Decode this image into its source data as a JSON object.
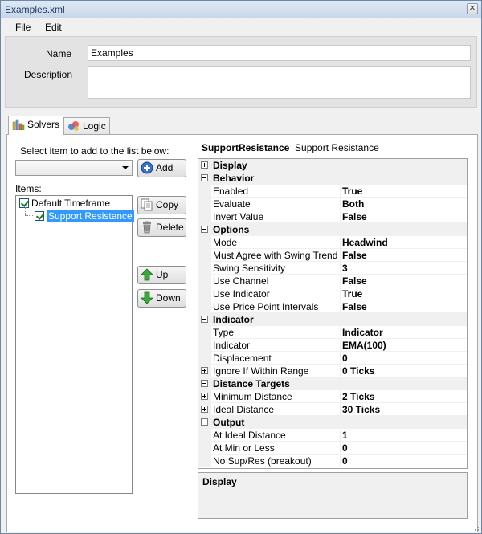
{
  "window": {
    "title": "Examples.xml",
    "close_glyph": "✕"
  },
  "menu": {
    "items": [
      "File",
      "Edit"
    ]
  },
  "header": {
    "name_label": "Name",
    "name_value": "Examples",
    "description_label": "Description",
    "description_value": ""
  },
  "tabs": [
    {
      "label": "Solvers",
      "icon": "solvers-chart-icon"
    },
    {
      "label": "Logic",
      "icon": "logic-icon"
    }
  ],
  "left": {
    "select_prompt": "Select item to add to the list below:",
    "combo_value": "",
    "items_label": "Items:",
    "tree": [
      {
        "label": "Default Timeframe",
        "checked": true,
        "selected": false
      },
      {
        "label": "Support Resistance",
        "checked": true,
        "selected": true
      }
    ],
    "buttons": {
      "add": "Add",
      "copy": "Copy",
      "delete": "Delete",
      "up": "Up",
      "down": "Down"
    }
  },
  "selected": {
    "type_name": "SupportResistance",
    "display_name": "Support Resistance"
  },
  "properties": [
    {
      "kind": "cat",
      "label": "Display",
      "expanded": false
    },
    {
      "kind": "cat",
      "label": "Behavior",
      "expanded": true
    },
    {
      "kind": "prop",
      "label": "Enabled",
      "value": "True"
    },
    {
      "kind": "prop",
      "label": "Evaluate",
      "value": "Both"
    },
    {
      "kind": "prop",
      "label": "Invert Value",
      "value": "False"
    },
    {
      "kind": "cat",
      "label": "Options",
      "expanded": true
    },
    {
      "kind": "prop",
      "label": "Mode",
      "value": "Headwind"
    },
    {
      "kind": "prop",
      "label": "Must Agree with Swing Trend",
      "value": "False"
    },
    {
      "kind": "prop",
      "label": "Swing Sensitivity",
      "value": "3"
    },
    {
      "kind": "prop",
      "label": "Use Channel",
      "value": "False"
    },
    {
      "kind": "prop",
      "label": "Use Indicator",
      "value": "True"
    },
    {
      "kind": "prop",
      "label": "Use Price Point Intervals",
      "value": "False"
    },
    {
      "kind": "cat",
      "label": "Indicator",
      "expanded": true
    },
    {
      "kind": "prop",
      "label": "Type",
      "value": "Indicator"
    },
    {
      "kind": "prop",
      "label": "Indicator",
      "value": "EMA(100)"
    },
    {
      "kind": "prop",
      "label": "Displacement",
      "value": "0"
    },
    {
      "kind": "propx",
      "label": "Ignore If Within Range",
      "value": "0 Ticks"
    },
    {
      "kind": "cat",
      "label": "Distance Targets",
      "expanded": true
    },
    {
      "kind": "propx",
      "label": "Minimum Distance",
      "value": "2 Ticks"
    },
    {
      "kind": "propx",
      "label": "Ideal Distance",
      "value": "30 Ticks"
    },
    {
      "kind": "cat",
      "label": "Output",
      "expanded": true
    },
    {
      "kind": "prop",
      "label": "At Ideal Distance",
      "value": "1"
    },
    {
      "kind": "prop",
      "label": "At Min or Less",
      "value": "0"
    },
    {
      "kind": "prop",
      "label": "No Sup/Res (breakout)",
      "value": "0"
    }
  ],
  "description_panel": {
    "title": "Display"
  }
}
